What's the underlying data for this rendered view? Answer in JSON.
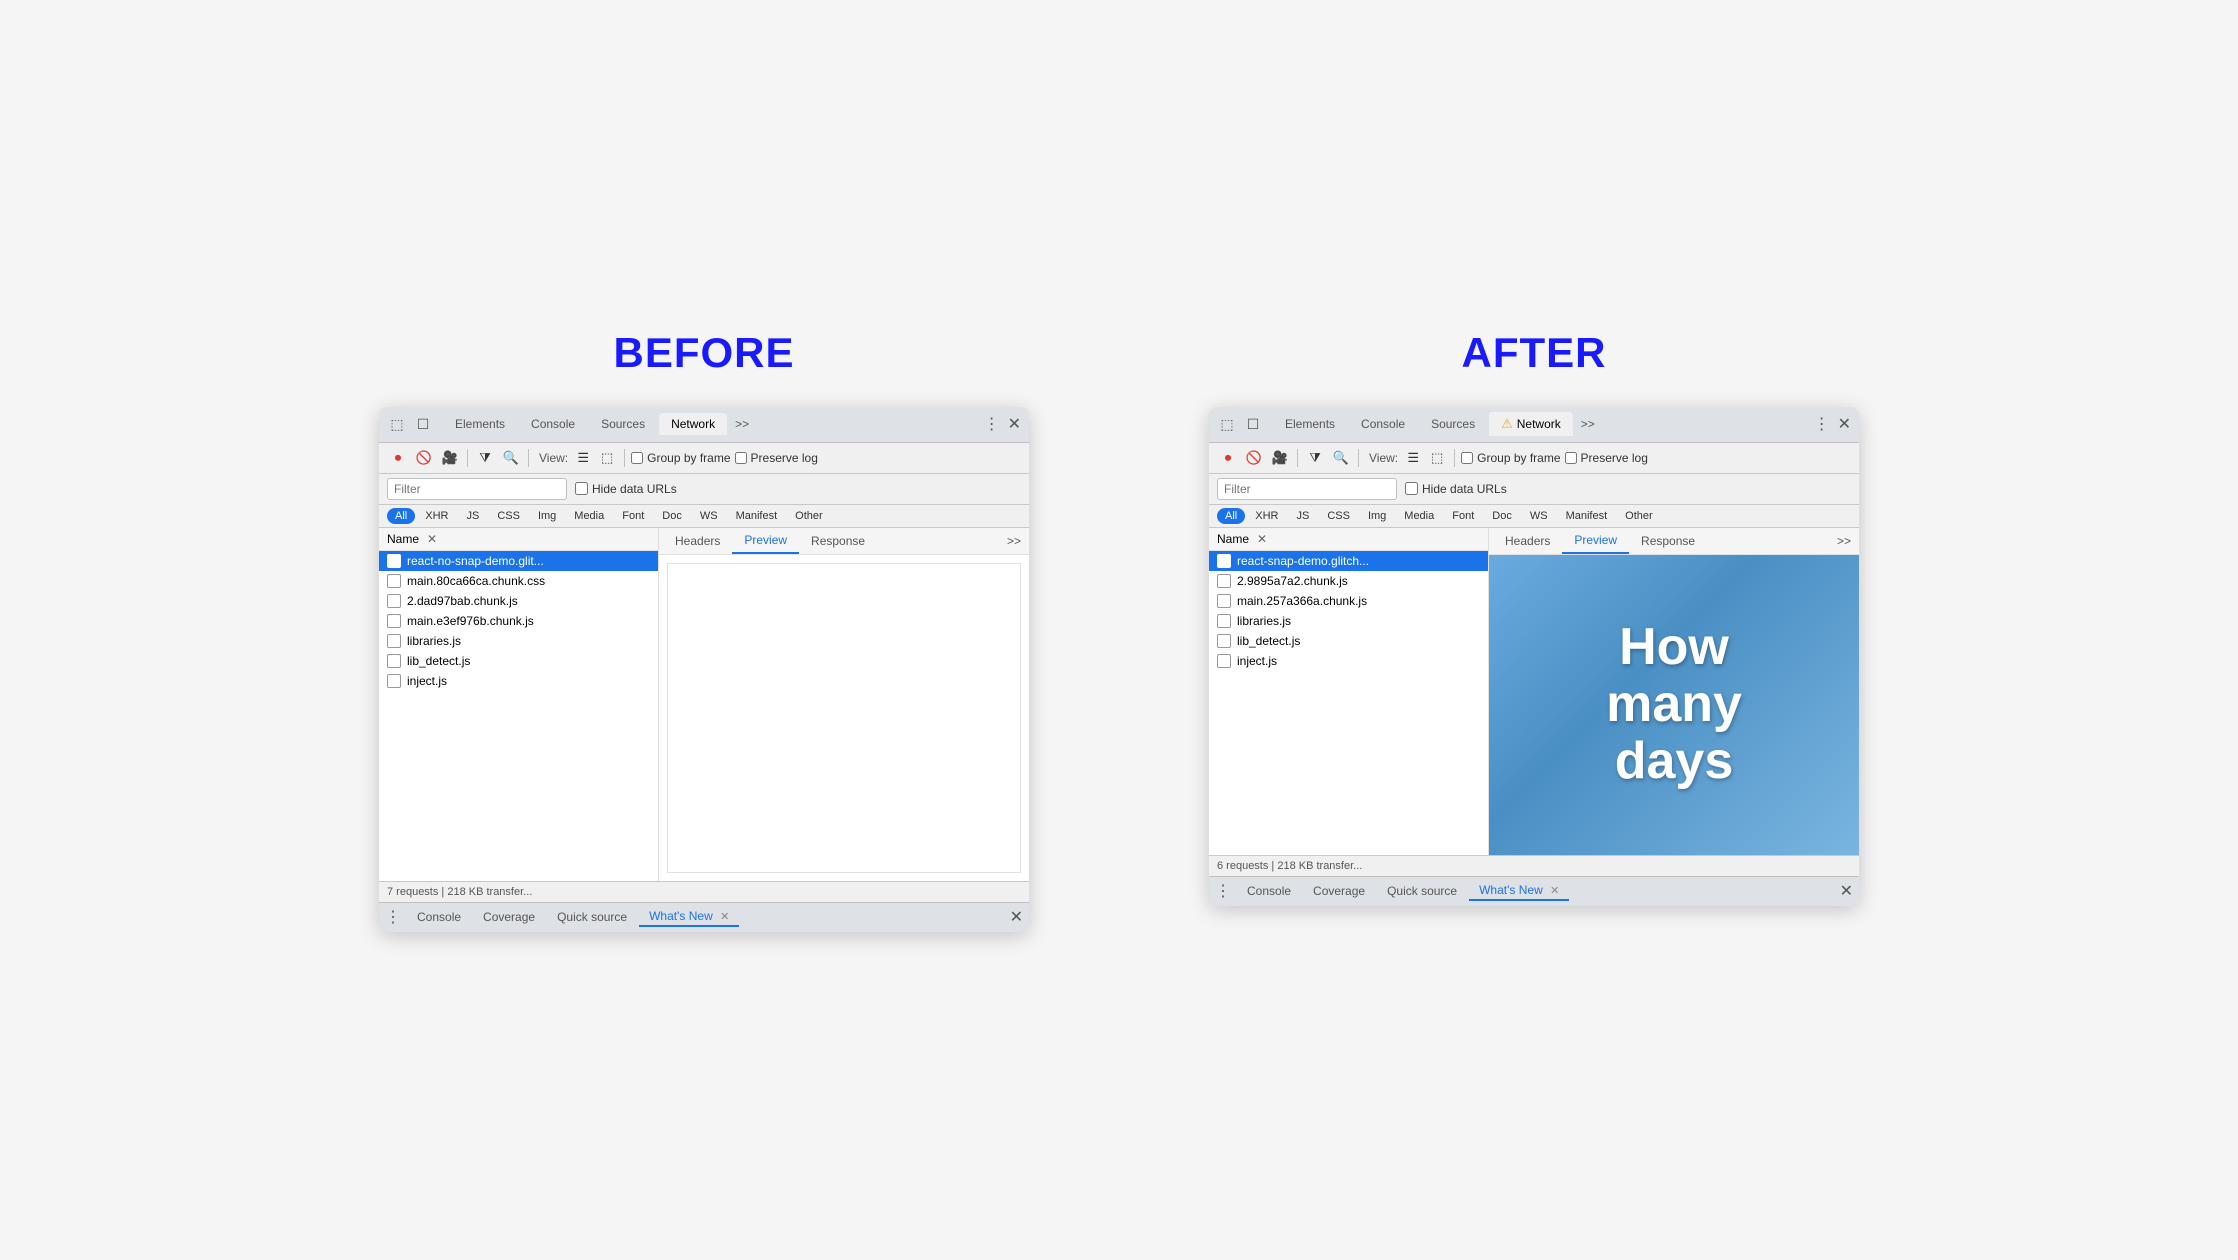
{
  "labels": {
    "before": "BEFORE",
    "after": "AFTER"
  },
  "before": {
    "tabs": [
      "Elements",
      "Console",
      "Sources",
      "Network",
      ">>"
    ],
    "active_tab": "Network",
    "toolbar": {
      "view_label": "View:",
      "group_by_frame": "Group by frame",
      "preserve_log": "Preserve log"
    },
    "filter": {
      "placeholder": "Filter",
      "hide_data_urls": "Hide data URLs"
    },
    "type_filters": [
      "All",
      "XHR",
      "JS",
      "CSS",
      "Img",
      "Media",
      "Font",
      "Doc",
      "WS",
      "Manifest",
      "Other"
    ],
    "active_type": "All",
    "file_list_header": "Name",
    "files": [
      "react-no-snap-demo.glit...",
      "main.80ca66ca.chunk.css",
      "2.dad97bab.chunk.js",
      "main.e3ef976b.chunk.js",
      "libraries.js",
      "lib_detect.js",
      "inject.js"
    ],
    "detail_tabs": [
      "Headers",
      "Preview",
      "Response",
      ">>"
    ],
    "active_detail_tab": "Preview",
    "preview_type": "empty",
    "status": "7 requests | 218 KB transfer...",
    "bottom_tabs": [
      "Console",
      "Coverage",
      "Quick source",
      "What's New"
    ],
    "active_bottom_tab": "What's New"
  },
  "after": {
    "tabs": [
      "Elements",
      "Console",
      "Sources",
      "Network",
      ">>"
    ],
    "active_tab": "Network",
    "has_warning": true,
    "toolbar": {
      "view_label": "View:",
      "group_by_frame": "Group by frame",
      "preserve_log": "Preserve log"
    },
    "filter": {
      "placeholder": "Filter",
      "hide_data_urls": "Hide data URLs"
    },
    "type_filters": [
      "All",
      "XHR",
      "JS",
      "CSS",
      "Img",
      "Media",
      "Font",
      "Doc",
      "WS",
      "Manifest",
      "Other"
    ],
    "active_type": "All",
    "file_list_header": "Name",
    "files": [
      "react-snap-demo.glitch...",
      "2.9895a7a2.chunk.js",
      "main.257a366a.chunk.js",
      "libraries.js",
      "lib_detect.js",
      "inject.js"
    ],
    "detail_tabs": [
      "Headers",
      "Preview",
      "Response",
      ">>"
    ],
    "active_detail_tab": "Preview",
    "preview_type": "image",
    "preview_text": "How\nmany\ndays",
    "status": "6 requests | 218 KB transfer...",
    "bottom_tabs": [
      "Console",
      "Coverage",
      "Quick source",
      "What's New"
    ],
    "active_bottom_tab": "What's New"
  }
}
